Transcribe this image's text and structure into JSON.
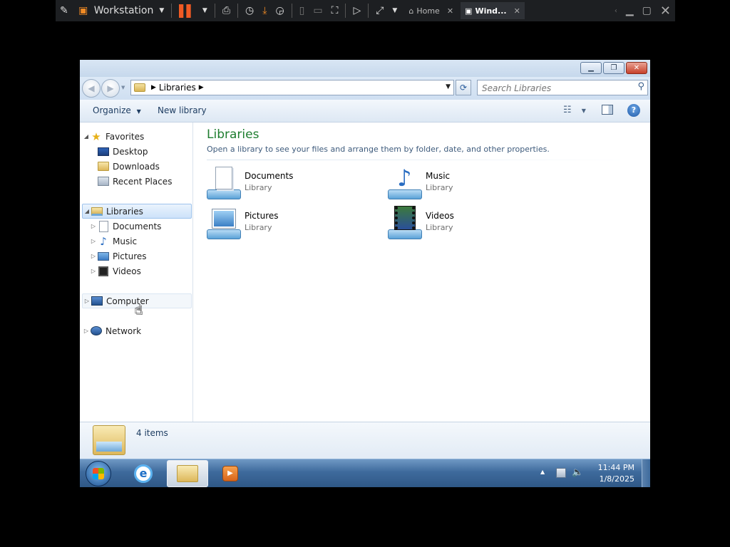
{
  "vm": {
    "menu_label": "Workstation",
    "tabs": [
      {
        "label": "Home"
      },
      {
        "label": "Wind..."
      }
    ]
  },
  "window": {
    "address": {
      "segments": [
        "Libraries"
      ]
    },
    "search": {
      "placeholder": "Search Libraries"
    },
    "command_bar": {
      "organize": "Organize",
      "new_library": "New library"
    }
  },
  "nav_pane": {
    "favorites": {
      "label": "Favorites",
      "items": [
        "Desktop",
        "Downloads",
        "Recent Places"
      ]
    },
    "libraries": {
      "label": "Libraries",
      "items": [
        "Documents",
        "Music",
        "Pictures",
        "Videos"
      ]
    },
    "computer": {
      "label": "Computer"
    },
    "network": {
      "label": "Network"
    }
  },
  "content": {
    "title": "Libraries",
    "subtitle": "Open a library to see your files and arrange them by folder, date, and other properties.",
    "items": [
      {
        "name": "Documents",
        "type": "Library",
        "icon": "documents-library-icon"
      },
      {
        "name": "Music",
        "type": "Library",
        "icon": "music-library-icon"
      },
      {
        "name": "Pictures",
        "type": "Library",
        "icon": "pictures-library-icon"
      },
      {
        "name": "Videos",
        "type": "Library",
        "icon": "videos-library-icon"
      }
    ]
  },
  "details": {
    "count": "4 items"
  },
  "taskbar": {
    "time": "11:44 PM",
    "date": "1/8/2025"
  },
  "colors": {
    "title_green": "#1e7d2f",
    "link_blue": "#1e3d62",
    "taskbar": "#3e6a9c"
  }
}
